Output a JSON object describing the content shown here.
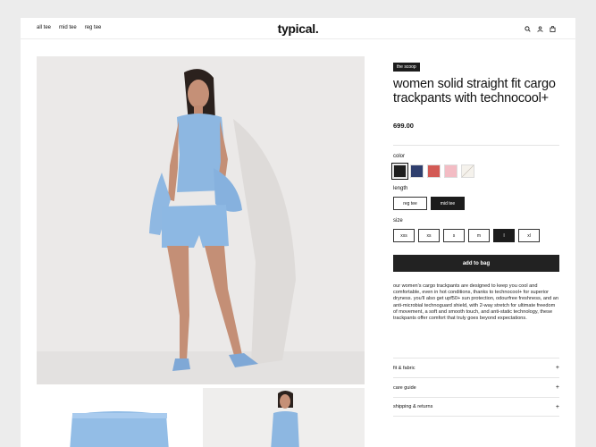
{
  "nav": {
    "items": [
      "all tee",
      "mid tee",
      "reg tee"
    ]
  },
  "brand": {
    "logo": "typical."
  },
  "header_icons": [
    "search-icon",
    "user-icon",
    "bag-icon"
  ],
  "product": {
    "badge": "the scoop",
    "title": "women solid straight fit cargo trackpants with technocool+",
    "price": "699.00",
    "color_label": "color",
    "colors": [
      "#1f1f1f",
      "#2f3f6e",
      "#d35a55",
      "#f3bcc4",
      "#f5f2ec"
    ],
    "length_label": "length",
    "lengths": [
      "reg tee",
      "mid tee"
    ],
    "length_selected": "mid tee",
    "size_label": "size",
    "sizes": [
      "xxs",
      "xs",
      "s",
      "m",
      "l",
      "xl"
    ],
    "size_selected": "l",
    "add_to_bag": "add to bag",
    "description": "our women's cargo trackpants are designed to keep you cool and comfortable, even in hot conditions, thanks to technocool+ for superior dryness. you'll also get upf50+ sun protection, odourfree freshness, and an anti-microbial technoguard shield, with 2-way stretch for ultimate freedom of movement, a soft and smooth touch, and anti-static technology, these trackpants offer comfort that truly goes beyond expectations."
  },
  "accordion": [
    {
      "label": "fit & fabric",
      "icon": "+"
    },
    {
      "label": "care guide",
      "icon": "+"
    },
    {
      "label": "shipping & returns",
      "icon": "+"
    }
  ]
}
